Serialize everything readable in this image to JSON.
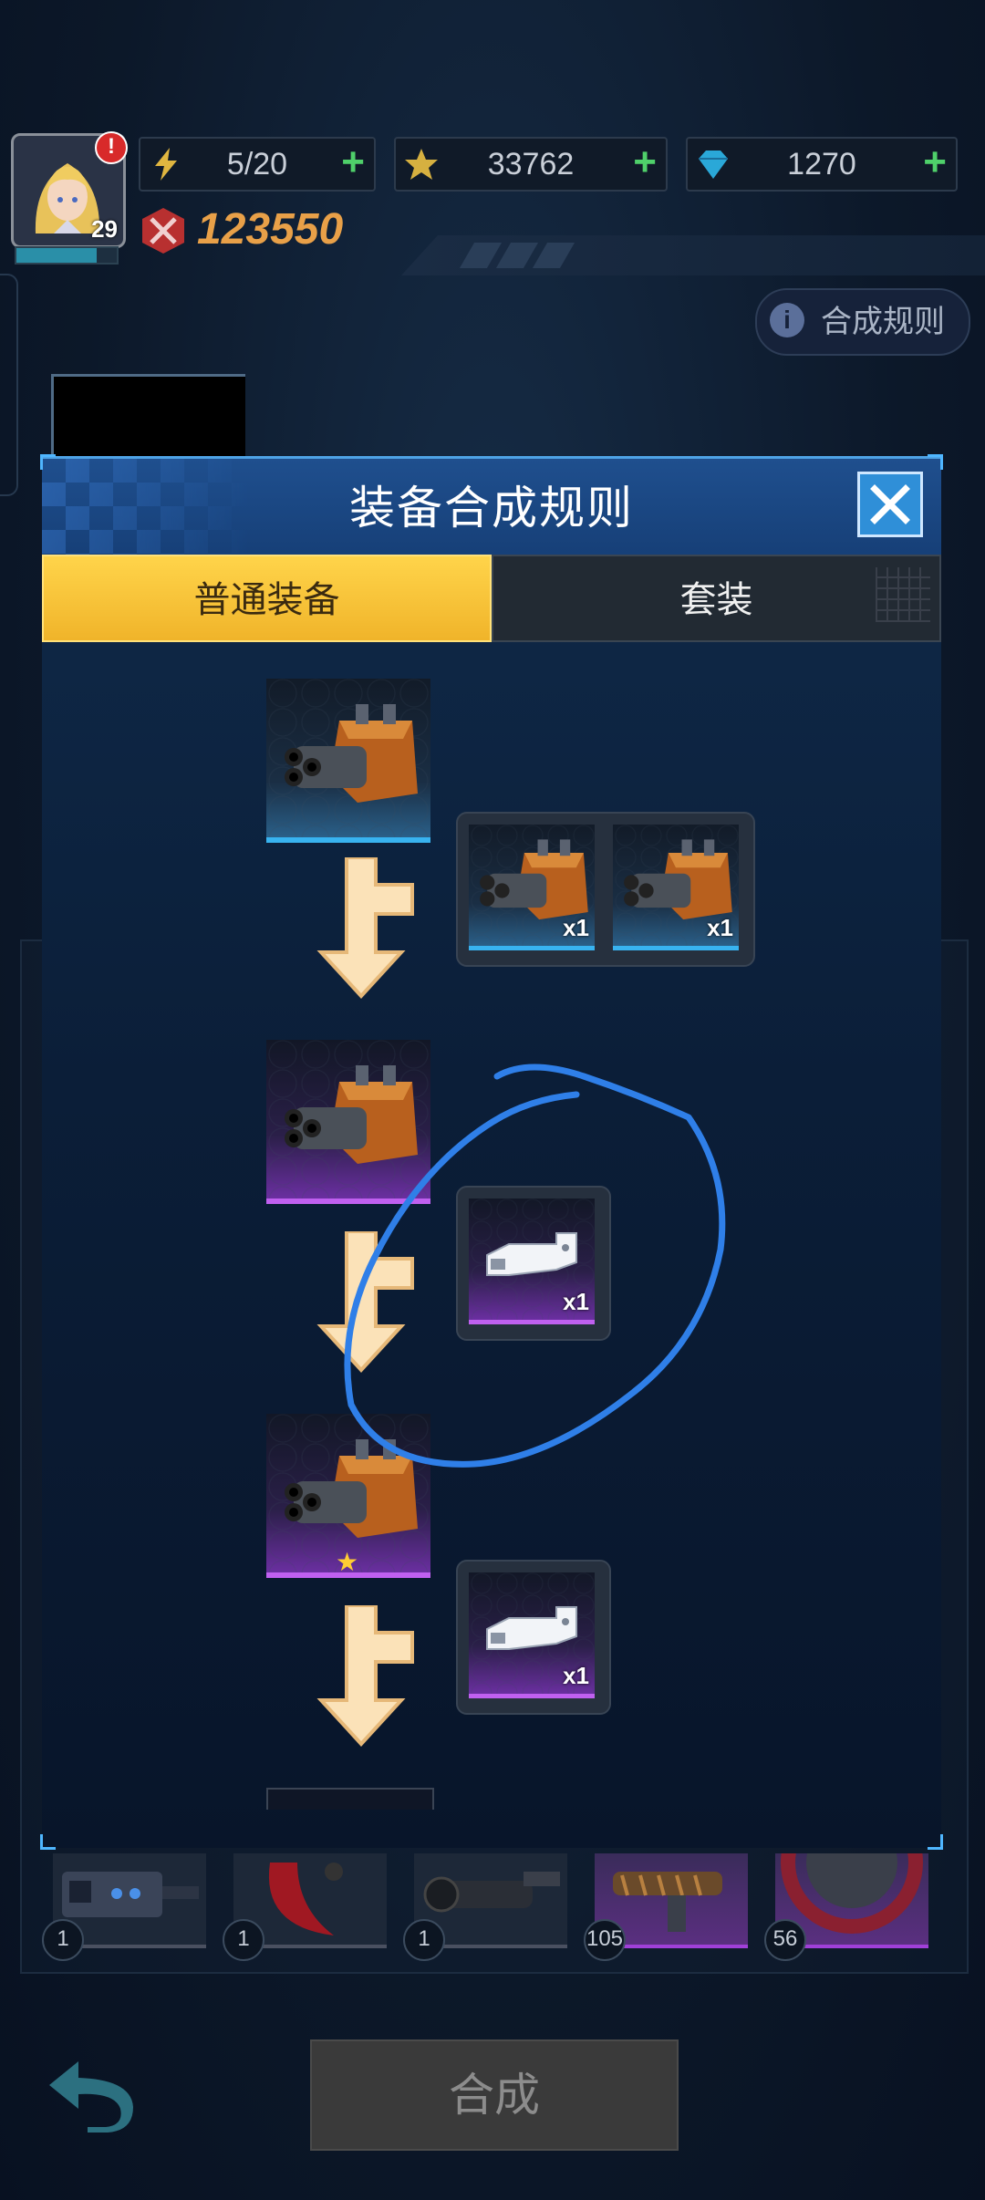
{
  "hud": {
    "level": "29",
    "alert": "!",
    "energy": "5/20",
    "gold": "33762",
    "gems": "1270",
    "power": "123550",
    "plus": "+"
  },
  "rules_button": {
    "label": "合成规则",
    "icon": "info-icon"
  },
  "modal": {
    "title": "装备合成规则",
    "tabs": [
      {
        "label": "普通装备",
        "active": true
      },
      {
        "label": "套装",
        "active": false
      }
    ],
    "steps": [
      {
        "result": "gatling-turret-blue",
        "materials": [
          {
            "item": "gatling-turret-blue",
            "qty": "x1"
          },
          {
            "item": "gatling-turret-blue",
            "qty": "x1"
          }
        ]
      },
      {
        "result": "gatling-turret-purple",
        "materials": [
          {
            "item": "barrel-module-purple",
            "qty": "x1"
          }
        ]
      },
      {
        "result": "gatling-turret-purple-star",
        "materials": [
          {
            "item": "barrel-module-purple",
            "qty": "x1"
          }
        ]
      }
    ]
  },
  "inventory_counts": [
    "1",
    "1",
    "1",
    "105",
    "56"
  ],
  "compose_button": "合成",
  "colors": {
    "accent_yellow": "#f0b42a",
    "blue_rarity": "#38b3f0",
    "purple_rarity": "#c060f0",
    "annotation_blue": "#2f7fe8"
  }
}
